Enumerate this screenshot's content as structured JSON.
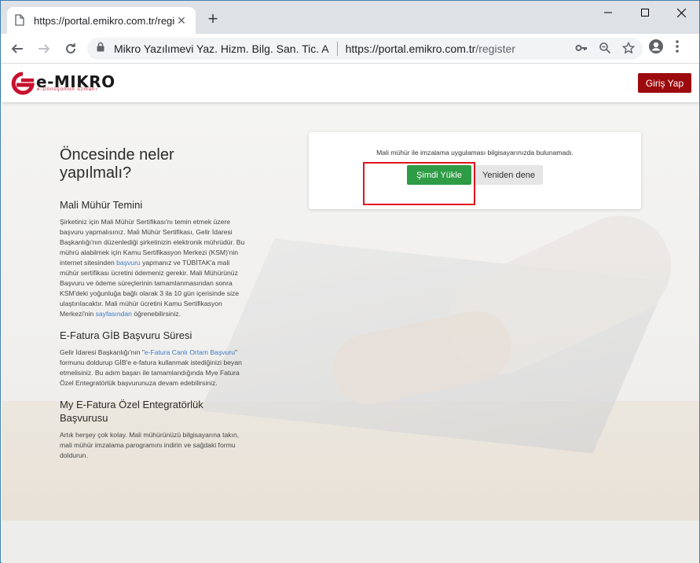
{
  "browser": {
    "tab_title": "https://portal.emikro.com.tr/regis",
    "new_tab": "+",
    "omnibox": {
      "org_name": "Mikro Yazılımevi Yaz. Hizm. Bilg. San. Tic. A",
      "url_host": "https://portal.emikro.com.tr",
      "url_path": "/register"
    }
  },
  "site": {
    "logo_text": "e-MIKRO",
    "logo_tagline": "e-Dönüşümün uzmanı",
    "login_label": "Giriş Yap",
    "brand_color": "#9d0a0e"
  },
  "info": {
    "heading": "Öncesinde neler yapılmalı?",
    "sections": [
      {
        "title": "Mali Mühür Temini",
        "text_a": "Şirketiniz için Mali Mühür Sertifikası'nı temin etmek üzere başvuru yapmalısınız. Mali Mühür Sertifikası, Gelir İdaresi Başkanlığı'nın düzenlediği şirketinizin elektronik mührüdür. Bu mührü alabilmek için Kamu Sertifikasyon Merkezi (KSM)'nin internet sitesinden ",
        "link_a": "başvuru",
        "text_b": " yapmanız ve TÜBİTAK'a mali mühür sertifikası ücretini ödemeniz gerekir. Mali Mühürünüz Başvuru ve ödeme süreçlerinin tamamlanmasından sonra KSM'deki yoğunluğa bağlı olarak 3 ila 10 gün içerisinde size ulaştırılacaktır. Mali mühür ücretini Kamu Sertifikasyon Merkezi'nin ",
        "link_b": "sayfasından",
        "text_c": " öğrenebilirsiniz."
      },
      {
        "title": "E-Fatura GİB Başvuru Süresi",
        "text_a": "Gelir İdaresi Başkanlığı'nın \"",
        "link_a": "e-Fatura Canlı Ortam Başvuru",
        "text_b": "\" formunu doldurup GİB'e e-fatura kullanmak istediğinizi beyan etmelisiniz. Bu adım başarı ile tamamlandığında Mye Fatura Özel Entegratörlük başvurunuza devam edebilirsiniz."
      },
      {
        "title": "My E-Fatura Özel Entegratörlük Başvurusu",
        "text_a": "Artık herşey çok kolay. Mali mühürünüzü bilgisayarına takın, mali mühür imzalama parogramını indirin ve sağdaki formu doldurun."
      }
    ]
  },
  "card": {
    "message": "Mali mühür ile imzalama uygulaması bilgisayarınızda bulunamadı.",
    "install_label": "Şimdi Yükle",
    "retry_label": "Yeniden dene",
    "install_color": "#2e9b45"
  }
}
